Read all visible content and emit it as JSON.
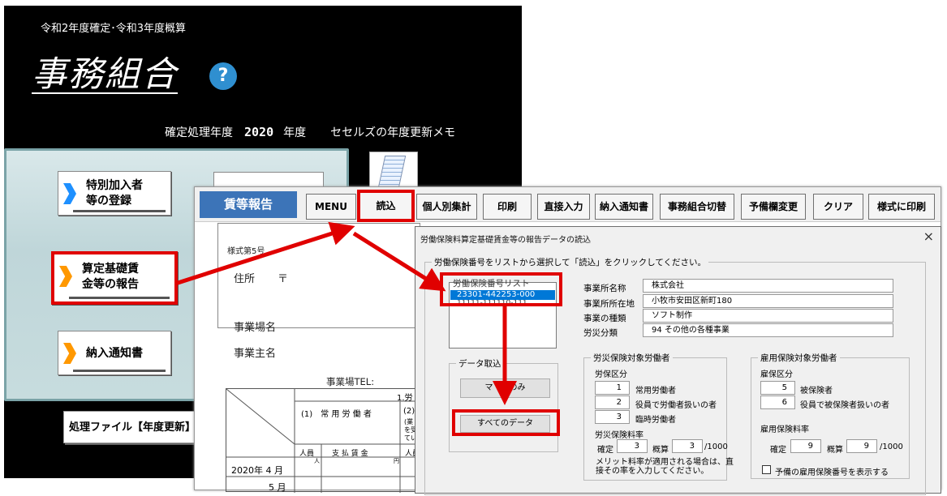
{
  "main_window": {
    "year_label": "令和2年度確定･令和3年度概算",
    "app_title": "事務組合",
    "help_icon": "?",
    "fiscal_label": "確定処理年度",
    "fiscal_year": "2020",
    "year_unit": "年度",
    "memo_label": "セセルズの年度更新メモ",
    "menu_buttons": [
      {
        "label": "特別加入者\n等の登録",
        "icon": "chevron-right-icon",
        "color": "#1e90ff"
      },
      {
        "label": "算定基礎賃\n金等の報告",
        "icon": "chevron-right-icon",
        "color": "#ff9800"
      },
      {
        "label": "納入通知書",
        "icon": "chevron-right-icon",
        "color": "#ff9800"
      }
    ],
    "file_button": "処理ファイル【年度更新】"
  },
  "report_window": {
    "title": "賃等報告",
    "toolbar": [
      "MENU",
      "読込",
      "個人別集計",
      "印刷",
      "直接入力",
      "納入通知書",
      "事務組合切替",
      "予備欄変更",
      "クリア",
      "様式に印刷"
    ],
    "form_number": "様式第5号",
    "address_label": "住所",
    "postal_mark": "〒",
    "business_name_label": "事業場名",
    "owner_label": "事業主名",
    "tel_label": "事業場TEL:",
    "grid": {
      "col1_label": "(1)　常 用 労 働 者",
      "col2_label": "(2)",
      "head_people": "人員",
      "head_wage": "支 払 賃 金",
      "head_people2": "人員",
      "unit_person": "人",
      "unit_yen": "円",
      "top_label": "1.労",
      "small_note": "(業\nを受\nてい",
      "rows": [
        "2020年 4 月",
        "5 月"
      ]
    }
  },
  "dialog": {
    "title": "労働保険料算定基礎賃金等の報告データの読込",
    "close": "×",
    "instruction": "労働保険番号をリストから選択して「読込」をクリックしてください。",
    "list_caption": "労働保険番号リスト",
    "list_items": [
      "23301-442253-000",
      "11111-111110-111"
    ],
    "import_group": "データ取込",
    "import_button_1": "マ　　のみ",
    "import_button_2": "すべてのデータ",
    "info": [
      {
        "label": "事業所名称",
        "value": "株式会社"
      },
      {
        "label": "事業所所在地",
        "value": "小牧市安田区新町180"
      },
      {
        "label": "事業の種類",
        "value": "ソフト制作"
      },
      {
        "label": "労災分類",
        "value": "94 その他の各種事業"
      }
    ],
    "workers_group": {
      "caption": "労災保険対象労働者",
      "category_label": "労保区分",
      "items": [
        {
          "num": "1",
          "label": "常用労働者"
        },
        {
          "num": "2",
          "label": "役員で労働者扱いの者"
        },
        {
          "num": "3",
          "label": "臨時労働者"
        }
      ],
      "rate_label": "労災保険料率",
      "confirmed_label": "確定",
      "confirmed_value": "3",
      "estimate_label": "概算",
      "estimate_value": "3",
      "per_unit": "/1000",
      "note": "メリット料率が適用される場合は、直\n接その率を入力してください。"
    },
    "employment_group": {
      "caption": "雇用保険対象労働者",
      "category_label": "雇保区分",
      "items": [
        {
          "num": "5",
          "label": "被保険者"
        },
        {
          "num": "6",
          "label": "役員で被保険者扱いの者"
        }
      ],
      "rate_label": "雇用保険料率",
      "confirmed_label": "確定",
      "confirmed_value": "9",
      "estimate_label": "概算",
      "estimate_value": "9",
      "per_unit": "/1000",
      "checkbox_label": "予備の雇用保険番号を表示する"
    }
  },
  "colors": {
    "highlight": "#e00000",
    "title_blue": "#3c74b8",
    "selection": "#0078d7"
  }
}
